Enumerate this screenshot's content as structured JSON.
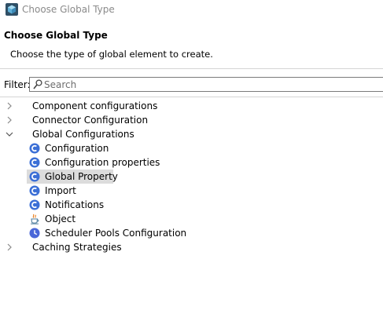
{
  "window": {
    "title": "Choose Global Type",
    "app_icon": "mule-cube-icon"
  },
  "header": {
    "title": "Choose Global Type",
    "description": "Choose the type of global element to create."
  },
  "filter": {
    "label": "Filter:",
    "placeholder": "Search",
    "value": ""
  },
  "tree": {
    "categories": [
      {
        "label": "Component configurations",
        "expanded": false
      },
      {
        "label": "Connector Configuration",
        "expanded": false
      },
      {
        "label": "Global Configurations",
        "expanded": true,
        "children": [
          {
            "label": "Configuration",
            "icon": "config-c-icon"
          },
          {
            "label": "Configuration properties",
            "icon": "config-c-icon"
          },
          {
            "label": "Global Property",
            "icon": "config-c-icon",
            "selected": true
          },
          {
            "label": "Import",
            "icon": "config-c-icon"
          },
          {
            "label": "Notifications",
            "icon": "config-c-icon"
          },
          {
            "label": "Object",
            "icon": "java-icon"
          },
          {
            "label": "Scheduler Pools Configuration",
            "icon": "clock-icon"
          }
        ]
      },
      {
        "label": "Caching Strategies",
        "expanded": false
      }
    ]
  },
  "colors": {
    "icon_blue": "#3b6fd6",
    "selection": "#dcdcdc",
    "title_gray": "#8a8a8a"
  }
}
